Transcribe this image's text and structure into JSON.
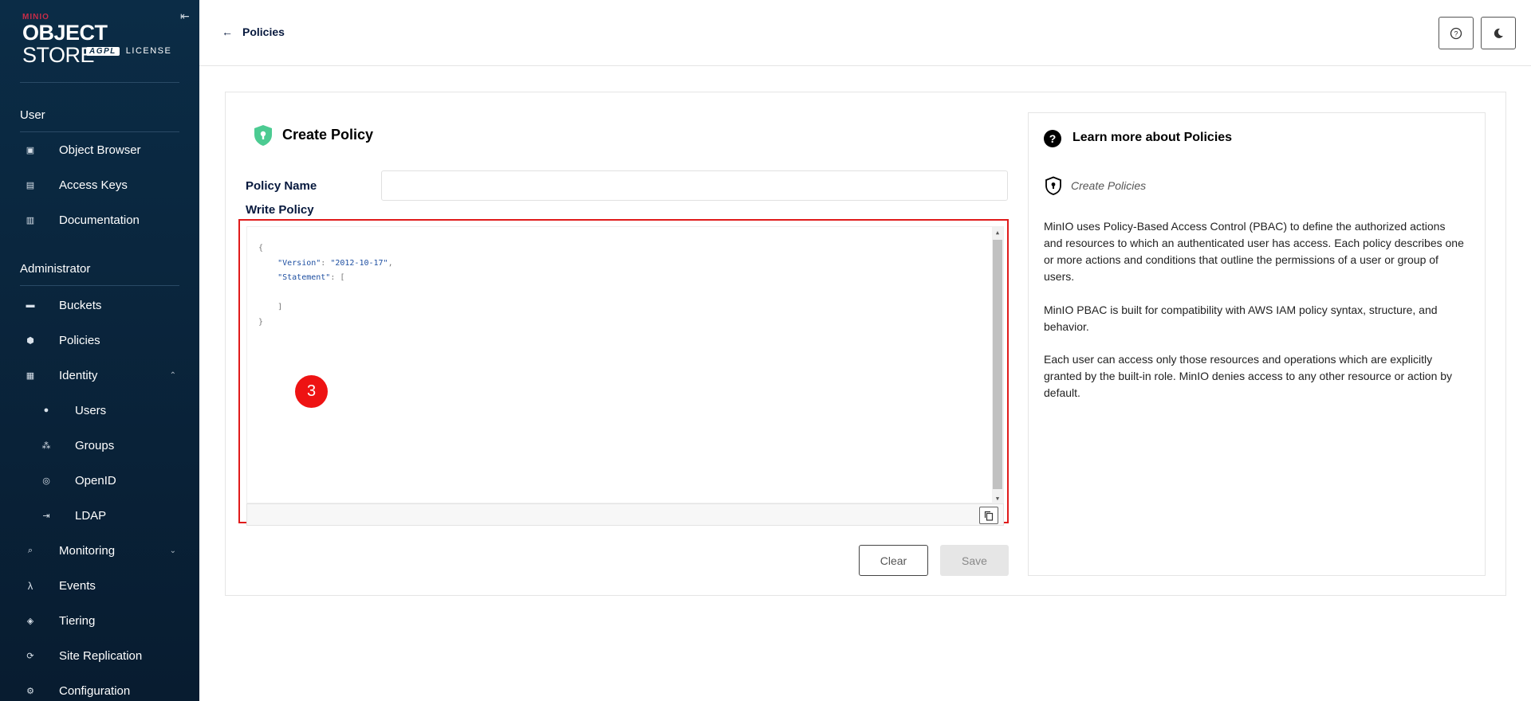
{
  "sidebar": {
    "logo": {
      "brand": "MINIO",
      "product_bold": "OBJECT",
      "product_thin": "STORE",
      "badge": "AGPL",
      "license": "LICENSE"
    },
    "collapse_icon": "collapse-icon",
    "sections": {
      "user": "User",
      "admin": "Administrator"
    },
    "items": [
      {
        "label": "Object Browser",
        "icon": "object-browser-icon"
      },
      {
        "label": "Access Keys",
        "icon": "access-keys-icon"
      },
      {
        "label": "Documentation",
        "icon": "documentation-icon"
      },
      {
        "label": "Buckets",
        "icon": "buckets-icon"
      },
      {
        "label": "Policies",
        "icon": "policies-icon"
      },
      {
        "label": "Identity",
        "icon": "identity-icon"
      },
      {
        "label": "Users",
        "icon": "users-icon"
      },
      {
        "label": "Groups",
        "icon": "groups-icon"
      },
      {
        "label": "OpenID",
        "icon": "openid-icon"
      },
      {
        "label": "LDAP",
        "icon": "ldap-icon"
      },
      {
        "label": "Monitoring",
        "icon": "monitoring-icon"
      },
      {
        "label": "Events",
        "icon": "events-icon"
      },
      {
        "label": "Tiering",
        "icon": "tiering-icon"
      },
      {
        "label": "Site Replication",
        "icon": "site-replication-icon"
      },
      {
        "label": "Configuration",
        "icon": "configuration-icon"
      }
    ]
  },
  "topbar": {
    "back_label": "Policies",
    "help_icon": "help-icon",
    "theme_icon": "dark-mode-icon"
  },
  "form": {
    "title": "Create Policy",
    "policy_name_label": "Policy Name",
    "policy_name_value": "",
    "write_policy_label": "Write Policy",
    "code": {
      "open_brace": "{",
      "version_key": "\"Version\"",
      "version_value": "\"2012-10-17\"",
      "statement_key": "\"Statement\"",
      "open_bracket": "[",
      "close_bracket": "]",
      "close_brace": "}"
    },
    "step_marker": "3",
    "clear_label": "Clear",
    "save_label": "Save"
  },
  "help": {
    "title": "Learn more about Policies",
    "subtitle": "Create Policies",
    "paragraphs": [
      "MinIO uses Policy-Based Access Control (PBAC) to define the authorized actions and resources to which an authenticated user has access. Each policy describes one or more actions and conditions that outline the permissions of a user or group of users.",
      "MinIO PBAC is built for compatibility with AWS IAM policy syntax, structure, and behavior.",
      "Each user can access only those resources and operations which are explicitly granted by the built-in role. MinIO denies access to any other resource or action by default."
    ]
  },
  "colors": {
    "sidebar_bg": "#0b2c46",
    "brand_red": "#c72c48",
    "highlight_red": "#e01b1b",
    "shield_green": "#4ccb92"
  }
}
